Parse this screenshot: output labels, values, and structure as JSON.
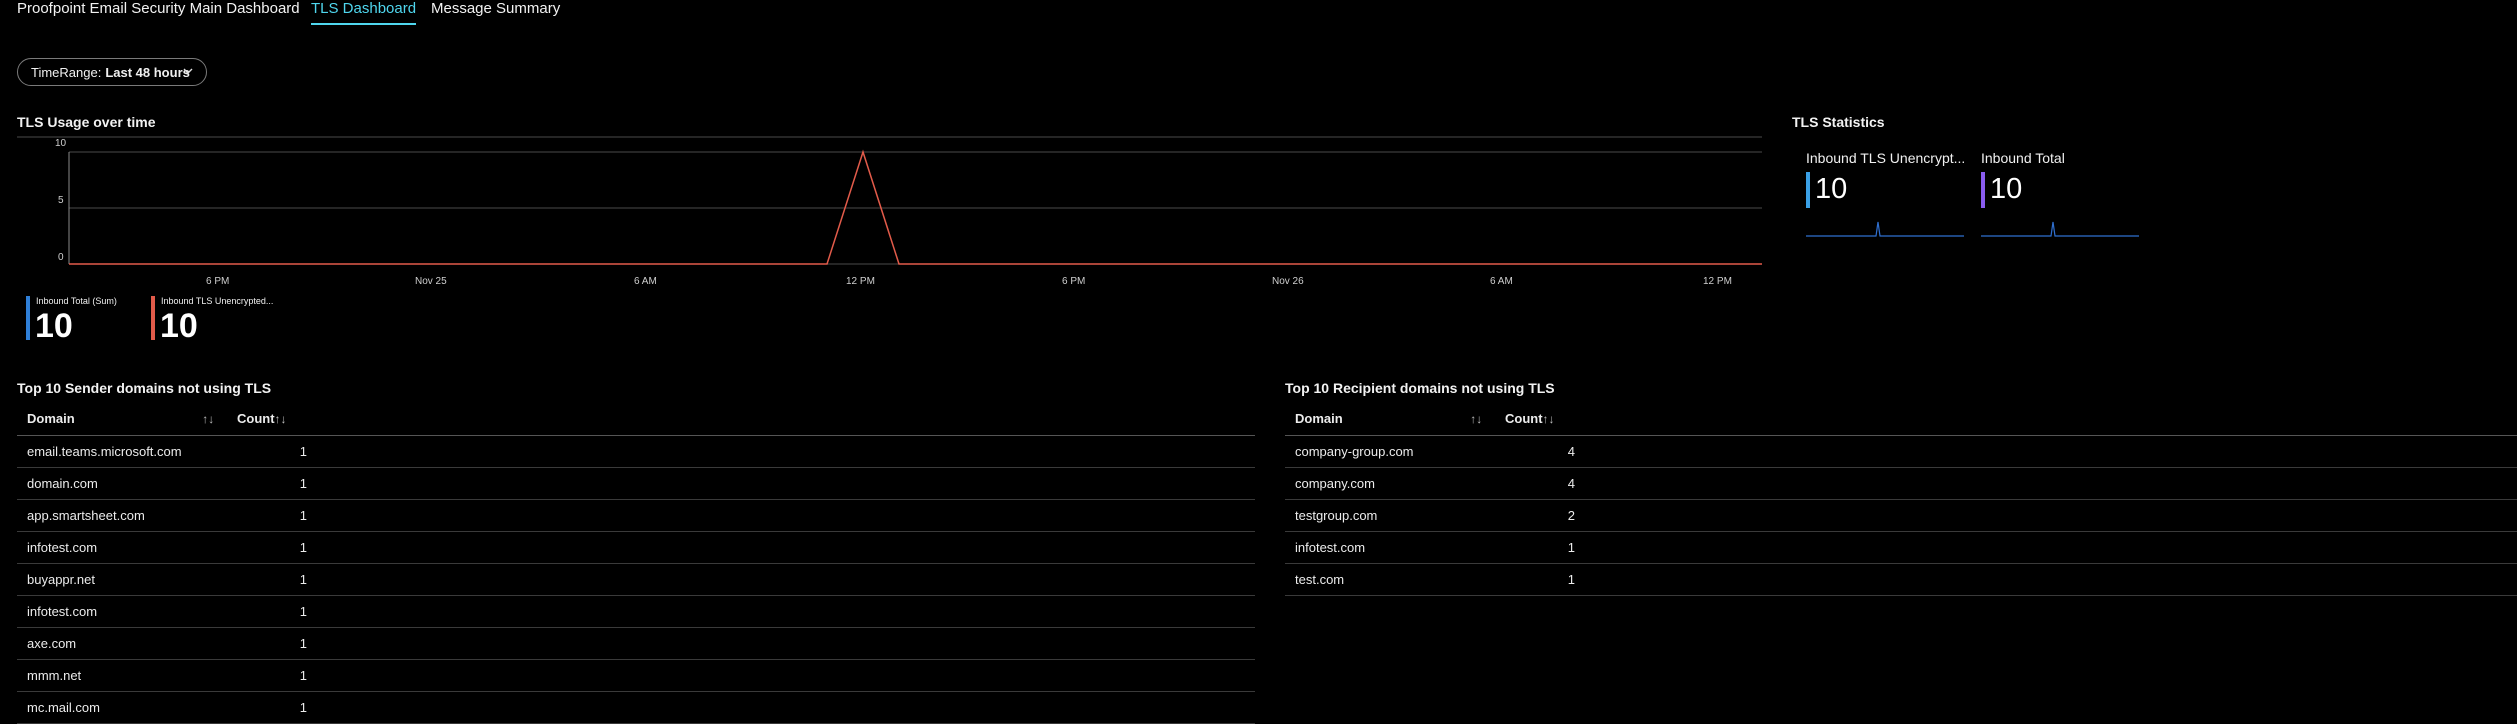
{
  "tabs": [
    {
      "label": "Proofpoint Email Security Main Dashboard"
    },
    {
      "label": "TLS Dashboard"
    },
    {
      "label": "Message Summary"
    }
  ],
  "time_range": {
    "label": "TimeRange:",
    "value": "Last 48 hours"
  },
  "tls_usage": {
    "title": "TLS Usage over time",
    "y_ticks": [
      "10",
      "5",
      "0"
    ],
    "x_ticks": [
      "6 PM",
      "Nov 25",
      "6 AM",
      "12 PM",
      "6 PM",
      "Nov 26",
      "6 AM",
      "12 PM"
    ],
    "colors": {
      "unencrypted": "#e25b4a",
      "total": "#2f7fd8"
    }
  },
  "chart_data": {
    "type": "line",
    "title": "TLS Usage over time",
    "ylim": [
      0,
      10
    ],
    "x": [
      "6 PM",
      "Nov 25",
      "6 AM",
      "12 PM",
      "6 PM",
      "Nov 26",
      "6 AM",
      "12 PM"
    ],
    "series": [
      {
        "name": "Inbound TLS Unencrypted",
        "peak_at": "12 PM (Nov 25)",
        "peak_value": 10,
        "other_values": 0
      }
    ]
  },
  "tiles": [
    {
      "label": "Inbound Total (Sum)",
      "value": "10",
      "color": "#2f7fd8"
    },
    {
      "label": "Inbound TLS Unencrypted...",
      "value": "10",
      "color": "#e25b4a"
    }
  ],
  "tls_stats": {
    "title": "TLS Statistics",
    "cards": [
      {
        "label": "Inbound TLS Unencrypt...",
        "value": "10",
        "color": "#3aa0e6"
      },
      {
        "label": "Inbound Total",
        "value": "10",
        "color": "#8a5cf0"
      }
    ]
  },
  "senders": {
    "title": "Top 10 Sender domains not using TLS",
    "col_domain": "Domain",
    "col_count": "Count",
    "sort_glyph": "↑↓",
    "rows": [
      {
        "domain": "email.teams.microsoft.com",
        "count": "1"
      },
      {
        "domain": "domain.com",
        "count": "1"
      },
      {
        "domain": "app.smartsheet.com",
        "count": "1"
      },
      {
        "domain": "infotest.com",
        "count": "1"
      },
      {
        "domain": "buyappr.net",
        "count": "1"
      },
      {
        "domain": "infotest.com",
        "count": "1"
      },
      {
        "domain": "axe.com",
        "count": "1"
      },
      {
        "domain": "mmm.net",
        "count": "1"
      },
      {
        "domain": "mc.mail.com",
        "count": "1"
      }
    ]
  },
  "recipients": {
    "title": "Top 10 Recipient domains not using TLS",
    "col_domain": "Domain",
    "col_count": "Count",
    "sort_glyph": "↑↓",
    "rows": [
      {
        "domain": "company-group.com",
        "count": "4"
      },
      {
        "domain": "company.com",
        "count": "4"
      },
      {
        "domain": "testgroup.com",
        "count": "2"
      },
      {
        "domain": "infotest.com",
        "count": "1"
      },
      {
        "domain": "test.com",
        "count": "1"
      }
    ]
  }
}
